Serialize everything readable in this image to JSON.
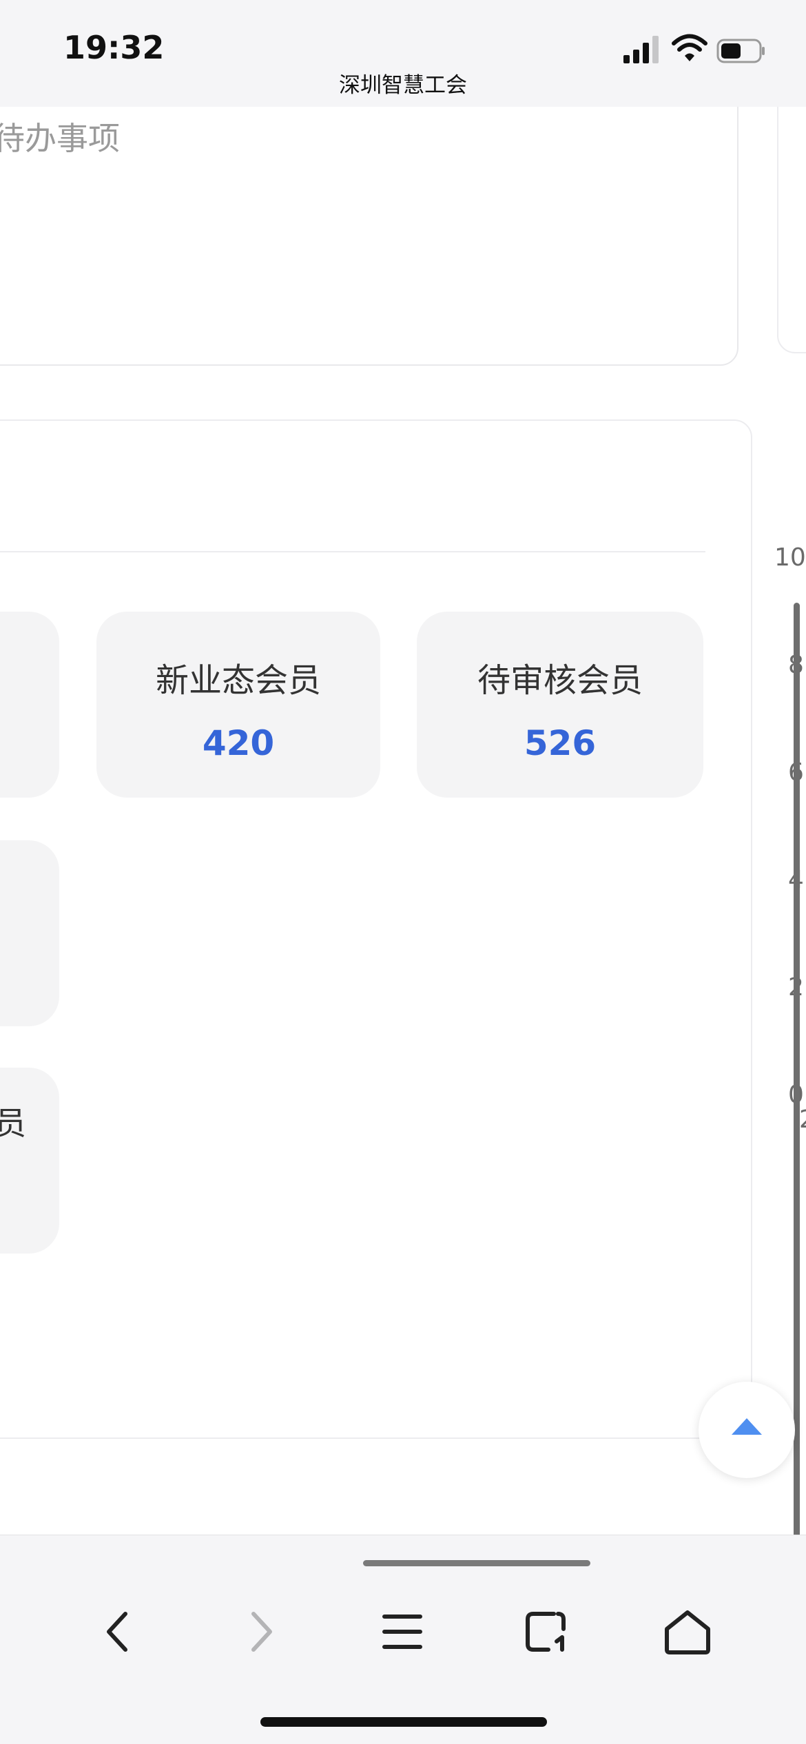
{
  "status_bar": {
    "time": "19:32",
    "page_title": "深圳智慧工会"
  },
  "todo": {
    "empty_text": "无待办事项"
  },
  "stats": {
    "tiles": [
      {
        "label": "新业态会员",
        "value": "420"
      },
      {
        "label": "待审核会员",
        "value": "526"
      }
    ],
    "partial_tile_label_fragment": "员"
  },
  "chart_axis": {
    "tick_labels": [
      "10",
      "8",
      "6",
      "4",
      "2",
      "0"
    ],
    "x_fragment": "2"
  },
  "colors": {
    "accent": "#3565d8",
    "scroll_top_arrow": "#4f8ff0",
    "tile_background": "#f4f4f5"
  },
  "icons": {
    "scroll_top": "triangle-up-icon",
    "toolbar": [
      "chevron-left-icon",
      "chevron-right-icon",
      "menu-icon",
      "tabs-icon",
      "home-icon"
    ]
  }
}
